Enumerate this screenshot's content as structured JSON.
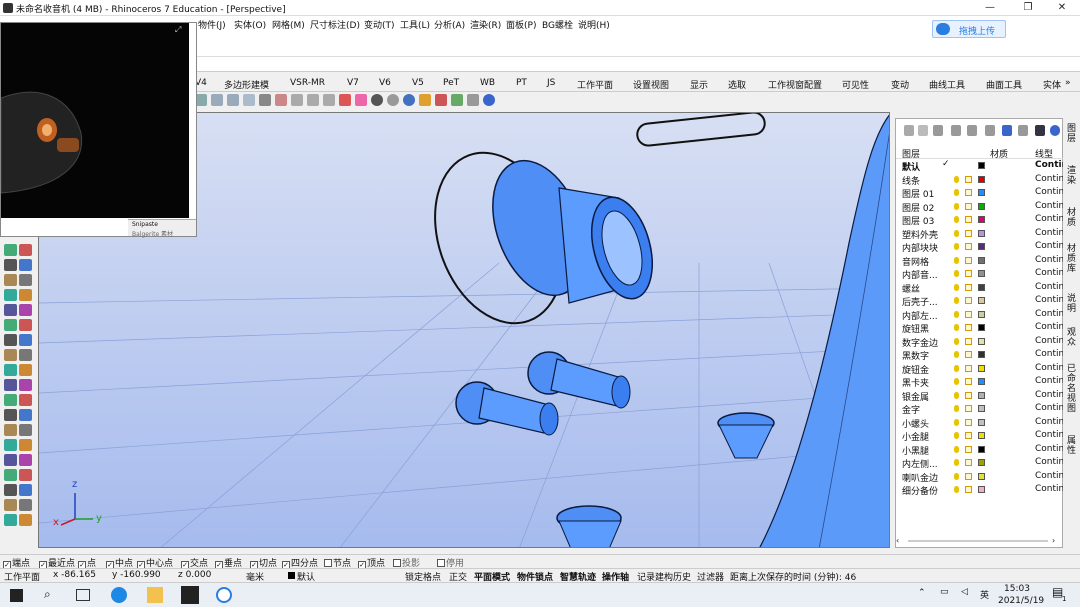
{
  "window": {
    "title": "未命名收音机 (4 MB) - Rhinoceros 7 Education - [Perspective]",
    "controls": [
      "—",
      "❐",
      "✕"
    ]
  },
  "menu": [
    "物件(J)",
    "实体(O)",
    "网格(M)",
    "尺寸标注(D)",
    "变动(T)",
    "工具(L)",
    "分析(A)",
    "渲染(R)",
    "面板(P)",
    "BG螺栓",
    "说明(H)"
  ],
  "upload": {
    "label": "拖拽上传"
  },
  "tabs": [
    "V4",
    "多边形建模",
    "VSR-MR",
    "V7",
    "V6",
    "V5",
    "PeT",
    "WB",
    "PT",
    "JS",
    "工作平面",
    "设置视图",
    "显示",
    "选取",
    "工作视窗配置",
    "可见性",
    "变动",
    "曲线工具",
    "曲面工具",
    "实体"
  ],
  "tabs_more": "»",
  "video": {
    "file_label": "Snipaste",
    "file_label2": "Balgerite 素材"
  },
  "layers": {
    "header": {
      "name": "图层",
      "material": "材质",
      "linetype": "线型"
    },
    "rows": [
      {
        "name": "默认",
        "color": "#000000",
        "linetype": "Contin",
        "current": true
      },
      {
        "name": "线条",
        "color": "#e00000",
        "linetype": "Contin"
      },
      {
        "name": "图层 01",
        "color": "#1e90ff",
        "linetype": "Contin"
      },
      {
        "name": "图层 02",
        "color": "#00b000",
        "linetype": "Contin"
      },
      {
        "name": "图层 03",
        "color": "#e0006e",
        "linetype": "Contin"
      },
      {
        "name": "塑料外壳",
        "color": "#c090e0",
        "linetype": "Contin"
      },
      {
        "name": "内部块块",
        "color": "#5a2a80",
        "linetype": "Contin"
      },
      {
        "name": "音网格",
        "color": "#707070",
        "linetype": "Contin"
      },
      {
        "name": "内部音...",
        "color": "#909090",
        "linetype": "Contin"
      },
      {
        "name": "螺丝",
        "color": "#404040",
        "linetype": "Contin"
      },
      {
        "name": "后壳子...",
        "color": "#d8c8a0",
        "linetype": "Contin"
      },
      {
        "name": "内部左...",
        "color": "#c8d0a0",
        "linetype": "Contin"
      },
      {
        "name": "旋钮黑",
        "color": "#000000",
        "linetype": "Contin"
      },
      {
        "name": "数字金边",
        "color": "#e8e0a0",
        "linetype": "Contin"
      },
      {
        "name": "黑数字",
        "color": "#303030",
        "linetype": "Contin"
      },
      {
        "name": "旋钮金",
        "color": "#f0e000",
        "linetype": "Contin"
      },
      {
        "name": "黑卡夹",
        "color": "#1e90ff",
        "linetype": "Contin"
      },
      {
        "name": "银金属",
        "color": "#b0b0b0",
        "linetype": "Contin"
      },
      {
        "name": "金字",
        "color": "#c0c0c0",
        "linetype": "Contin"
      },
      {
        "name": "小螺头",
        "color": "#c0c0c0",
        "linetype": "Contin"
      },
      {
        "name": "小金腿",
        "color": "#f0e000",
        "linetype": "Contin"
      },
      {
        "name": "小黑腿",
        "color": "#000000",
        "linetype": "Contin"
      },
      {
        "name": "内左侧...",
        "color": "#a0a000",
        "linetype": "Contin"
      },
      {
        "name": "喇叭金边",
        "color": "#e0e040",
        "linetype": "Contin"
      },
      {
        "name": "细分备份",
        "color": "#f0b0c0",
        "linetype": "Contin"
      }
    ]
  },
  "sidetabs": [
    "图层",
    "渲染",
    "材质",
    "材质库",
    "说明",
    "观众",
    "已命名视图",
    "属性"
  ],
  "osnap": [
    {
      "label": "端点",
      "checked": true
    },
    {
      "label": "最近点",
      "checked": true
    },
    {
      "label": "点",
      "checked": true
    },
    {
      "label": "中点",
      "checked": true
    },
    {
      "label": "中心点",
      "checked": true
    },
    {
      "label": "交点",
      "checked": true
    },
    {
      "label": "垂点",
      "checked": true
    },
    {
      "label": "切点",
      "checked": true
    },
    {
      "label": "四分点",
      "checked": true
    },
    {
      "label": "节点",
      "checked": false
    },
    {
      "label": "顶点",
      "checked": true
    },
    {
      "label": "投影",
      "checked": false
    },
    {
      "label": "停用",
      "checked": false
    }
  ],
  "status": {
    "cplane": "工作平面",
    "x": "x -86.165",
    "y": "y -160.990",
    "z": "z 0.000",
    "unit": "毫米",
    "layer": "默认",
    "toggles": [
      "锁定格点",
      "正交",
      "平面模式",
      "物件锁点",
      "智慧轨迹",
      "操作轴",
      "记录建构历史",
      "过滤器"
    ],
    "saved": "距离上次保存的时间 (分钟): 46"
  },
  "axes": {
    "x": "x",
    "y": "y",
    "z": "z"
  },
  "taskbar": {
    "time": "15:03",
    "date": "2021/5/19",
    "lang": "英",
    "notify": "1"
  },
  "colors": {
    "accent": "#2a7de1",
    "surface": "#5a9cff",
    "viewport_bg": "#b8c8f0"
  }
}
